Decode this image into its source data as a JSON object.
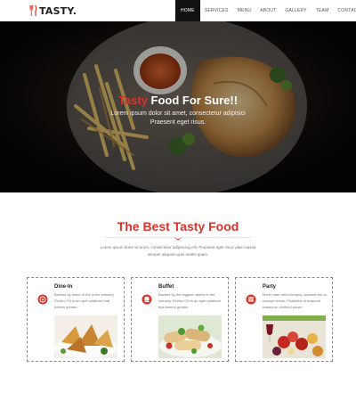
{
  "brand": {
    "name": "TASTY.",
    "logo_icon": "fork-knife-icon",
    "accent_color": "#d9342b"
  },
  "nav": {
    "items": [
      {
        "label": "HOME",
        "active": true
      },
      {
        "label": "SERVICES",
        "active": false
      },
      {
        "label": "MENU",
        "active": false
      },
      {
        "label": "ABOUT",
        "active": false
      },
      {
        "label": "GALLERY",
        "active": false
      },
      {
        "label": "TEAM",
        "active": false
      },
      {
        "label": "CONTACT",
        "active": false
      }
    ]
  },
  "hero": {
    "title_accent": "Tasty",
    "title_rest": " Food For Sure!!",
    "subtitle_line1": "Lorem ipsum dolor sit amet, consectetur adipisici",
    "subtitle_line2": "Praesent eget risus."
  },
  "section": {
    "title": "The Best Tasty Food",
    "desc_line1": "Lorem ipsum dolor sit amet, consectetur adipiscing elit. Praesent eget risus vitae massa",
    "desc_line2": "semper aliquam quis mattis quam."
  },
  "cards": [
    {
      "title": "Dine-In",
      "icon": "plate-icon",
      "text": "Backed by some of the in the industry, Firefox OS is an open platform that fosters greater"
    },
    {
      "title": "Buffet",
      "icon": "chef-hat-icon",
      "text": "Backed by the biggest names in the industry, Firefox OS is an open platform that fosters greater"
    },
    {
      "title": "Party",
      "icon": "cake-icon",
      "text": "Morbi vitae tortor tempus, placerat leo et, suscipit lectus. Phasellus ut euismod massa eu eleifend ipsum."
    }
  ]
}
